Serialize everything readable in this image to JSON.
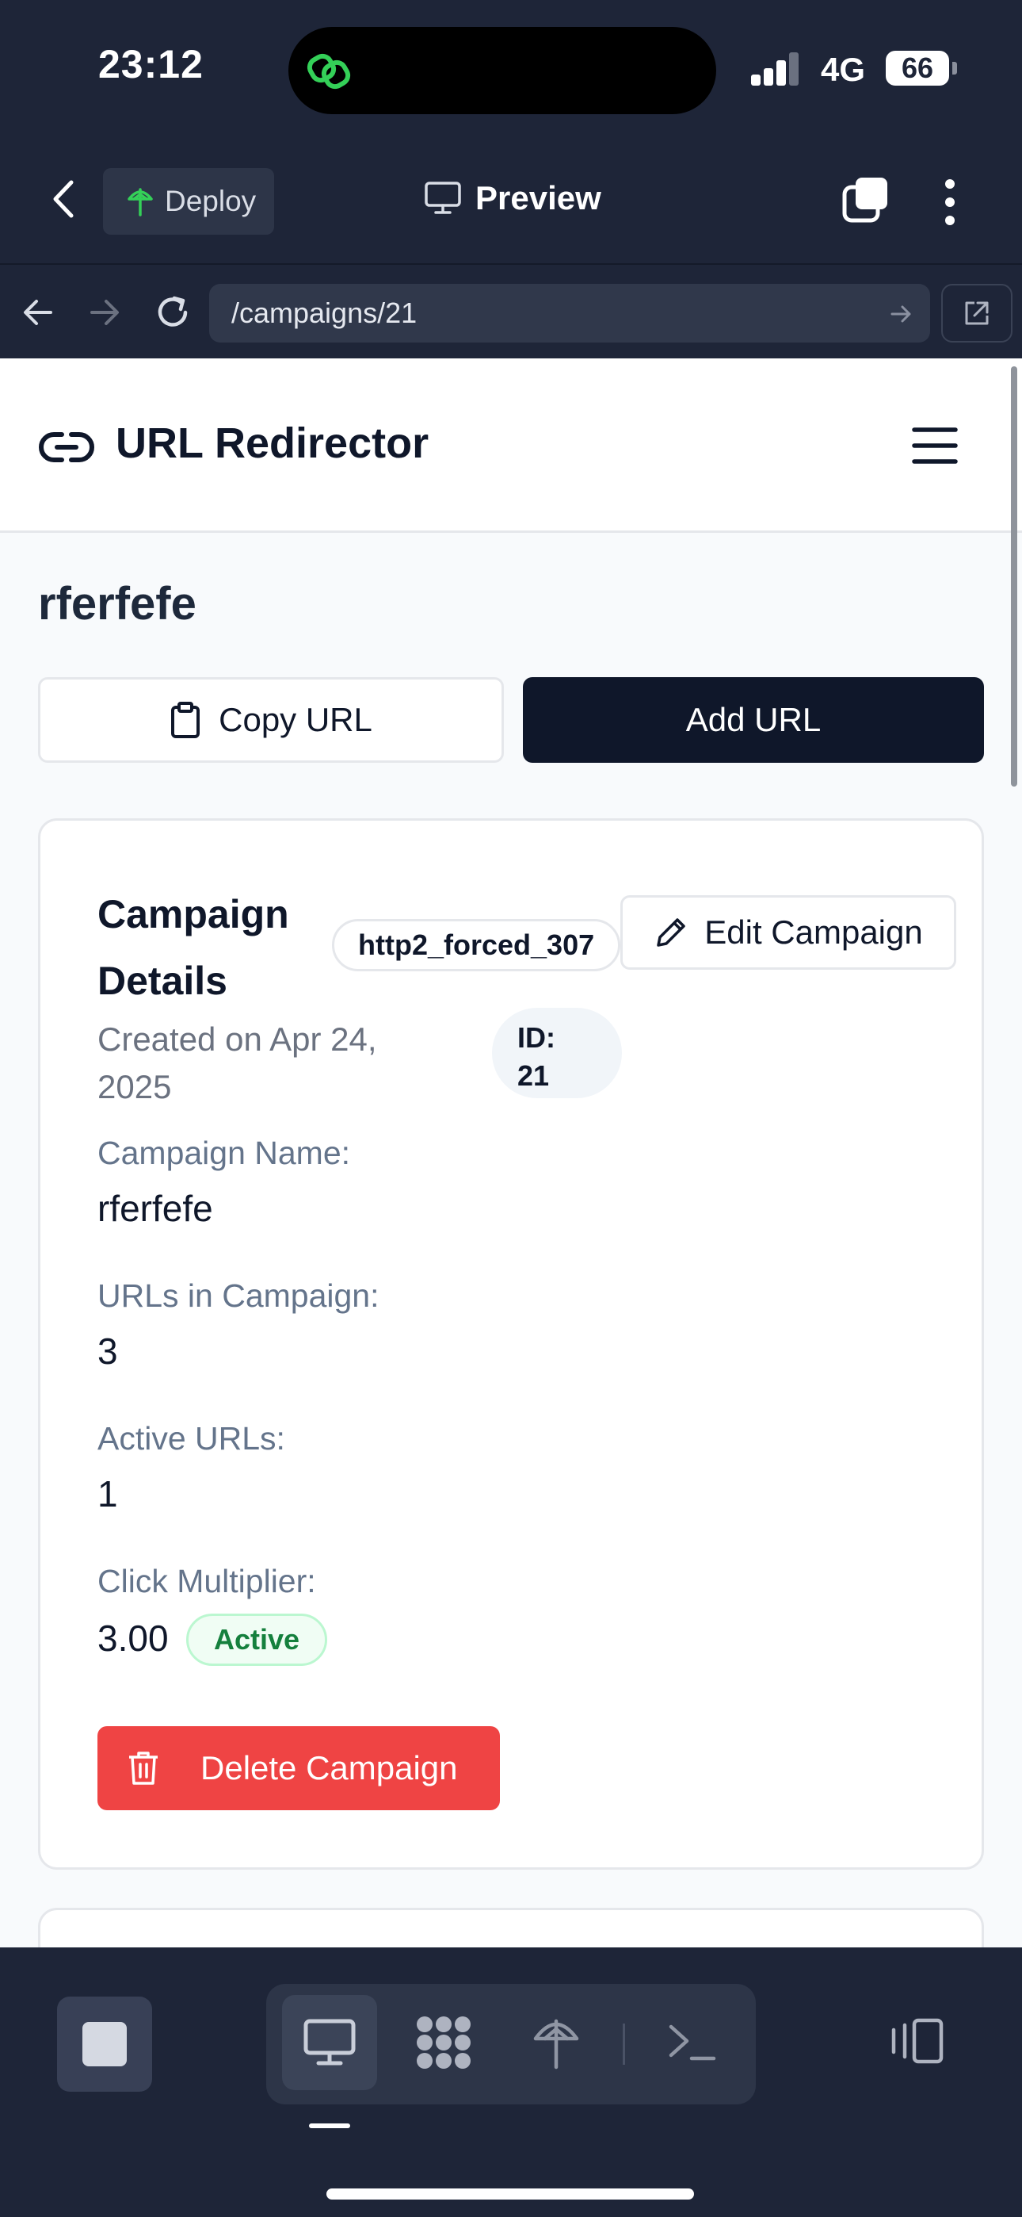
{
  "status_bar": {
    "time": "23:12",
    "network": "4G",
    "battery": "66"
  },
  "toolbar": {
    "deploy_label": "Deploy",
    "preview_label": "Preview"
  },
  "browser": {
    "url": "/campaigns/21"
  },
  "site": {
    "title": "URL Redirector"
  },
  "page": {
    "title": "rferfefe",
    "copy_label": "Copy URL",
    "add_label": "Add URL"
  },
  "campaign": {
    "card_title": "Campaign Details",
    "scenario_badge": "http2_forced_307",
    "edit_label": "Edit Campaign",
    "created": "Created on Apr 24, 2025",
    "id_label": "ID:",
    "id_value": "21",
    "fields": [
      {
        "label": "Campaign Name:",
        "value": "rferfefe"
      },
      {
        "label": "URLs in Campaign:",
        "value": "3"
      },
      {
        "label": "Active URLs:",
        "value": "1"
      },
      {
        "label": "Click Multiplier:",
        "value": "3.00"
      }
    ],
    "multiplier_status": "Active",
    "delete_label": "Delete Campaign"
  },
  "colors": {
    "primary": "#0f172a",
    "danger": "#ef4444",
    "success": "#15803d",
    "chrome": "#1e2538"
  },
  "icons": {
    "copy": "clipboard-icon",
    "edit": "pencil-icon",
    "delete": "trash-icon",
    "logo": "link-icon"
  }
}
